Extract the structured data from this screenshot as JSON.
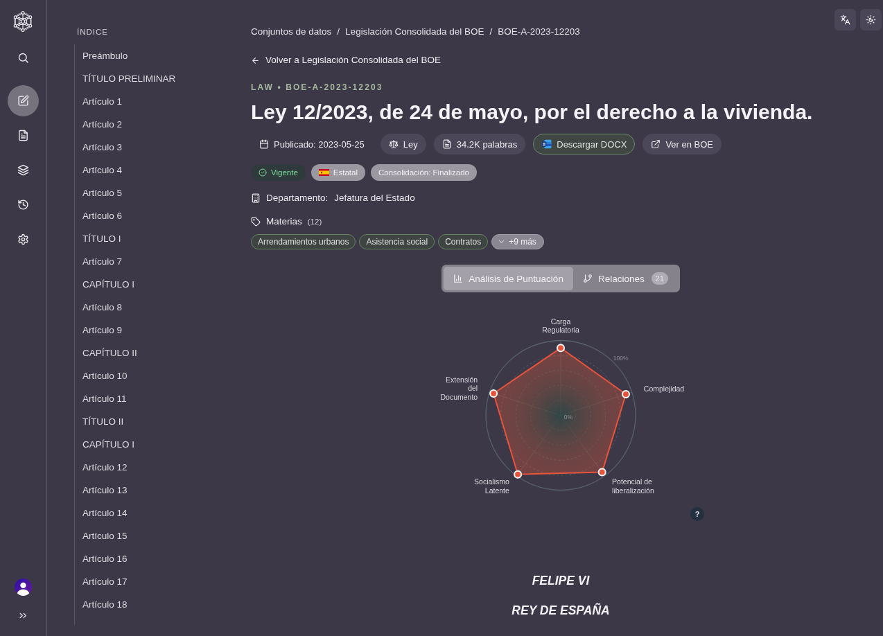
{
  "rail": {
    "items": [
      {
        "kind": "search",
        "selected": false
      },
      {
        "kind": "edit",
        "selected": true
      },
      {
        "kind": "document",
        "selected": false
      },
      {
        "kind": "layers",
        "selected": false
      },
      {
        "kind": "history",
        "selected": false
      },
      {
        "kind": "settings",
        "selected": false
      }
    ]
  },
  "index": {
    "title": "ÍNDICE",
    "items": [
      "Preámbulo",
      "TÍTULO PRELIMINAR",
      "Artículo 1",
      "Artículo 2",
      "Artículo 3",
      "Artículo 4",
      "Artículo 5",
      "Artículo 6",
      "TÍTULO I",
      "Artículo 7",
      "CAPÍTULO I",
      "Artículo 8",
      "Artículo 9",
      "CAPÍTULO II",
      "Artículo 10",
      "Artículo 11",
      "TÍTULO II",
      "CAPÍTULO I",
      "Artículo 12",
      "Artículo 13",
      "Artículo 14",
      "Artículo 15",
      "Artículo 16",
      "Artículo 17",
      "Artículo 18"
    ]
  },
  "breadcrumb": {
    "items": [
      "Conjuntos de datos",
      "Legislación Consolidada del BOE",
      "BOE-A-2023-12203"
    ],
    "separator": "/"
  },
  "back_link": "Volver a Legislación Consolidada del BOE",
  "eyebrow": "LAW • BOE-A-2023-12203",
  "title": "Ley 12/2023, de 24 de mayo, por el derecho a la vivienda.",
  "meta": [
    {
      "kind": "date",
      "label": "Publicado: 2023-05-25"
    },
    {
      "kind": "type",
      "label": "Ley"
    },
    {
      "kind": "words",
      "label": "34.2K palabras"
    },
    {
      "kind": "download",
      "label": "Descargar DOCX"
    },
    {
      "kind": "link",
      "label": "Ver en BOE"
    }
  ],
  "badges": [
    {
      "kind": "status",
      "label": "Vigente"
    },
    {
      "kind": "scope",
      "label": "Estatal"
    },
    {
      "kind": "plain",
      "label": "Consolidación: Finalizado"
    }
  ],
  "department": {
    "label": "Departamento:",
    "value": "Jefatura del Estado"
  },
  "subjects": {
    "label": "Materias",
    "count": "(12)",
    "tags": [
      "Arrendamientos urbanos",
      "Asistencia social",
      "Contratos"
    ],
    "more": "+9 más"
  },
  "tabs": [
    {
      "kind": "chart",
      "label": "Análisis de Puntuación",
      "selected": true
    },
    {
      "kind": "branch",
      "label": "Relaciones",
      "badge": "21",
      "selected": false
    }
  ],
  "score_chart": {
    "axis_labels": [
      "Carga Regulatoria",
      "Extensión del Documento",
      "Complejidad",
      "Socialismo Latente",
      "Potencial de liberalización"
    ],
    "scale_labels": [
      "100%",
      "0%"
    ],
    "help": "?"
  },
  "signature": [
    "FELIPE VI",
    "REY DE ESPAÑA"
  ]
}
